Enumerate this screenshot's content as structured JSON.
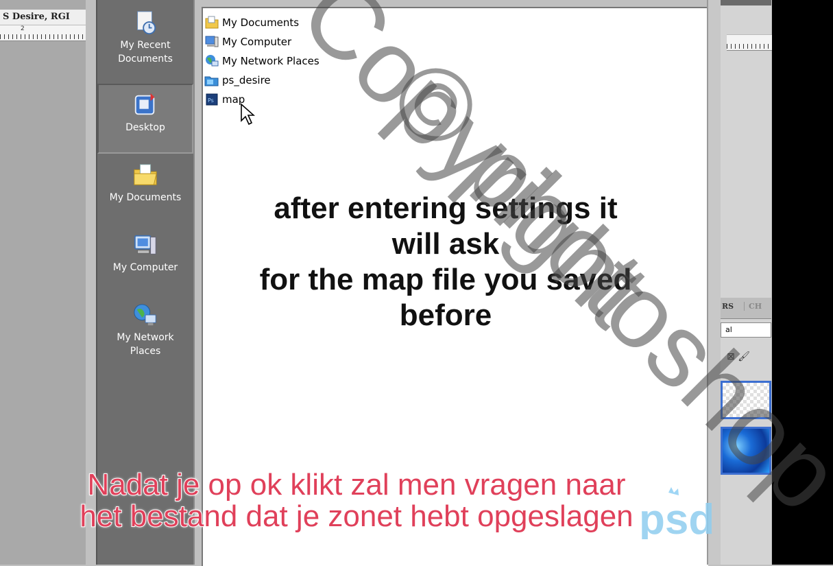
{
  "photoshop": {
    "document_title": "S Desire, RGI",
    "ruler_mark": "2",
    "panel_tabs": [
      "RS",
      "CH"
    ],
    "blend_mode": "al"
  },
  "places_bar": [
    {
      "label_lines": [
        "My Recent",
        "Documents"
      ],
      "icon": "recent-documents-icon",
      "selected": false
    },
    {
      "label_lines": [
        "Desktop"
      ],
      "icon": "desktop-icon",
      "selected": true
    },
    {
      "label_lines": [
        "My Documents"
      ],
      "icon": "my-documents-icon",
      "selected": false
    },
    {
      "label_lines": [
        "My Computer"
      ],
      "icon": "my-computer-icon",
      "selected": false
    },
    {
      "label_lines": [
        "My Network",
        "Places"
      ],
      "icon": "my-network-places-icon",
      "selected": false
    }
  ],
  "file_list": [
    {
      "name": "My Documents",
      "icon": "folder-icon"
    },
    {
      "name": "My Computer",
      "icon": "computer-icon"
    },
    {
      "name": "My Network Places",
      "icon": "network-icon"
    },
    {
      "name": "ps_desire",
      "icon": "ps-folder-icon"
    },
    {
      "name": "map",
      "icon": "psd-file-icon"
    }
  ],
  "instruction_lines": [
    "after entering settings it",
    "will ask",
    "for the map file you saved",
    "before"
  ],
  "subtitle_lines": [
    "Nadat je op ok klikt zal men vragen naar",
    "het bestand dat je zonet hebt opgeslagen"
  ],
  "logo_text": "psd",
  "watermark_text": "Copyright © photoshop",
  "colors": {
    "places_bg": "#6e6e6e",
    "subtitle": "#e0405a",
    "selection_blue": "#3c6fd1",
    "watermark": "rgba(60,60,60,0.55)"
  }
}
